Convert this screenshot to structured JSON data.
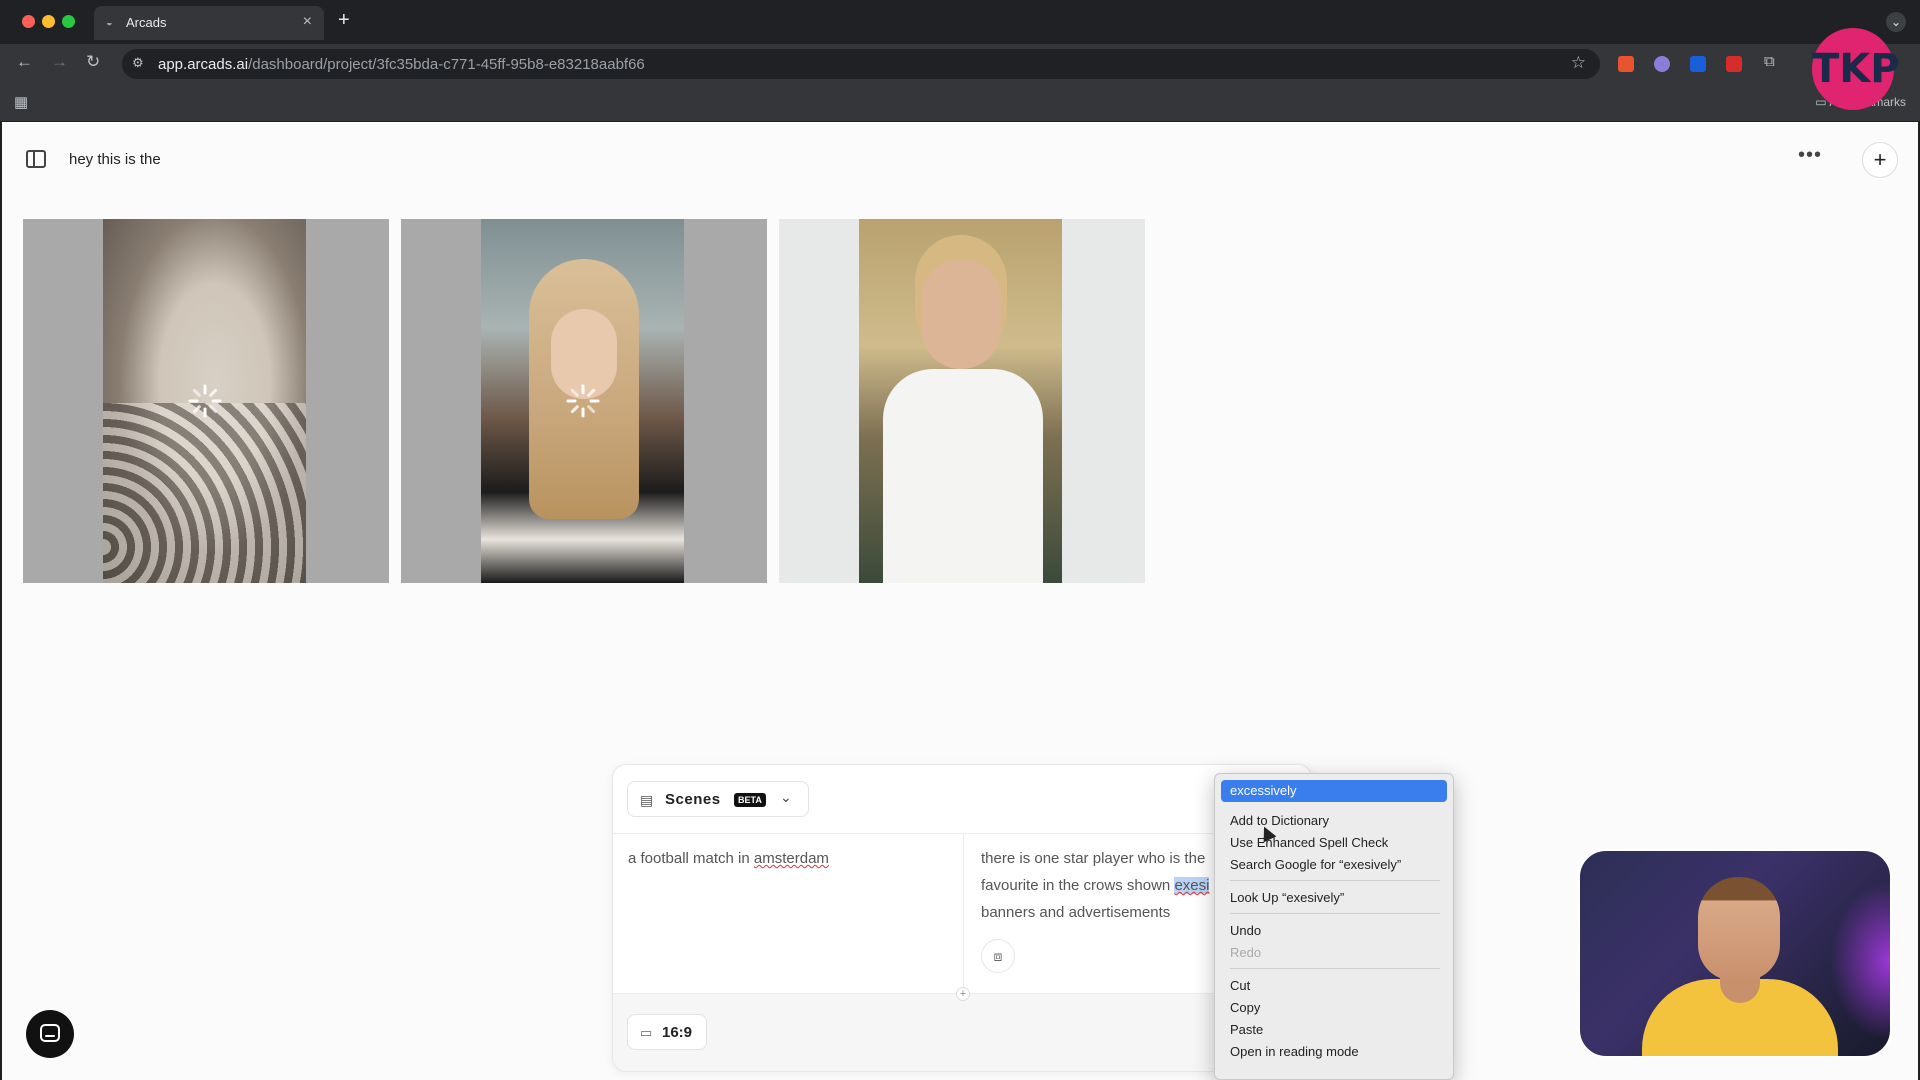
{
  "browser": {
    "tab_title": "Arcads",
    "tab_close": "×",
    "new_tab": "+",
    "url_host": "app.arcads.ai",
    "url_path": "/dashboard/project/3fc35bda-c771-45ff-95b8-e83218aabf66",
    "bookmarks_label": "All Bookmarks",
    "profile_initials": "TKP",
    "extension_colors": [
      "#e8542f",
      "#8a7fd6",
      "#1a5fd9",
      "#d72c2c"
    ]
  },
  "header": {
    "project_title": "hey this is the",
    "more_label": "•••",
    "add_label": "+"
  },
  "videos": [
    {
      "name": "dog",
      "state": "loading"
    },
    {
      "name": "girl-in-car",
      "state": "loading"
    },
    {
      "name": "doctor",
      "state": "ready"
    }
  ],
  "scenes": {
    "dropdown_label": "Scenes",
    "badge": "BETA",
    "scene_1_text_a": "a football match in ",
    "scene_1_text_b": "amsterdam",
    "scene_2_line_1": "there is one star player who is the",
    "scene_2_line_2a": "favourite in the crows shown ",
    "scene_2_line_2b": "exesi",
    "scene_2_line_3": "banners and advertisements",
    "add_scene": "+",
    "aspect_ratio": "16:9"
  },
  "context_menu": {
    "suggestion": "excessively",
    "add_to_dictionary": "Add to Dictionary",
    "enhanced_spell_check": "Use Enhanced Spell Check",
    "search_google": "Search Google for “exesively”",
    "look_up": "Look Up “exesively”",
    "undo": "Undo",
    "redo": "Redo",
    "cut": "Cut",
    "copy": "Copy",
    "paste": "Paste",
    "reading_mode": "Open in reading mode"
  }
}
